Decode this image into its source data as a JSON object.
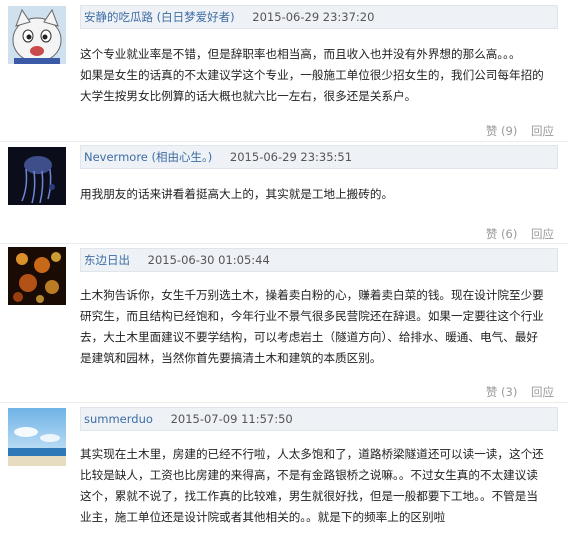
{
  "comments": [
    {
      "username": "安静的吃瓜路",
      "note": "(白日梦爱好者)",
      "time": "2015-06-29 23:37:20",
      "lines": [
        "这个专业就业率是不错，但是辞职率也相当高，而且收入也并没有外界想的那么高。。。",
        "如果是女生的话真的不太建议学这个专业，一般施工单位很少招女生的，我们公司每年招的",
        "大学生按男女比例算的话大概也就六比一左右，很多还是关系户。"
      ],
      "like": "赞 (9)",
      "reply": "回应",
      "avatar_icon": "cartoon-cat-avatar"
    },
    {
      "username": "Nevermore",
      "note": "(相由心生。)",
      "time": "2015-06-29 23:35:51",
      "lines": [
        "用我朋友的话来讲看着挺高大上的，其实就是工地上搬砖的。"
      ],
      "like": "赞 (6)",
      "reply": "回应",
      "avatar_icon": "dark-jellyfish-avatar"
    },
    {
      "username": "东边日出",
      "note": "",
      "time": "2015-06-30 01:05:44",
      "lines": [
        "土木狗告诉你，女生千万别选土木，操着卖白粉的心，赚着卖白菜的钱。现在设计院至少要",
        "研究生，而且结构已经饱和，今年行业不景气很多民营院还在辞退。如果一定要往这个行业",
        "去，大土木里面建议不要学结构，可以考虑岩土（隧道方向）、给排水、暖通、电气、最好",
        "是建筑和园林，当然你首先要搞清土木和建筑的本质区别。"
      ],
      "like": "赞 (3)",
      "reply": "回应",
      "avatar_icon": "fire-lights-avatar"
    },
    {
      "username": "summerduo",
      "note": "",
      "time": "2015-07-09 11:57:50",
      "lines": [
        "其实现在土木里，房建的已经不行啦，人太多饱和了，道路桥梁隧道还可以读一读，这个还",
        "比较是缺人，工资也比房建的来得高，不是有金路银桥之说嘛。。不过女生真的不太建议读",
        "这个，累就不说了，找工作真的比较难，男生就很好找，但是一般都要下工地。。不管是当",
        "业主，施工单位还是设计院或者其他相关的。。就是下的频率上的区别啦"
      ],
      "avatar_icon": "beach-sky-avatar"
    }
  ]
}
